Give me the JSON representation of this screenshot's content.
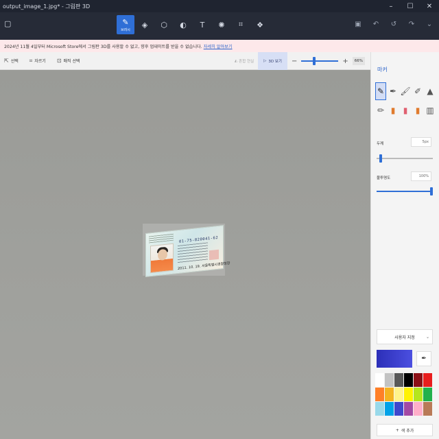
{
  "window": {
    "title": "output_image_1.jpg* - 그림판 3D",
    "controls": [
      "minimize-icon",
      "maximize-icon",
      "close-icon"
    ]
  },
  "toolbar": {
    "menu_icon": "menu-icon",
    "tools": [
      {
        "icon": "brush-icon",
        "label": "브러시",
        "active": true
      },
      {
        "icon": "shapes2d-icon",
        "label": "",
        "active": false
      },
      {
        "icon": "shapes3d-icon",
        "label": "",
        "active": false
      },
      {
        "icon": "sticker-icon",
        "label": "",
        "active": false
      },
      {
        "icon": "text-icon",
        "label": "",
        "active": false
      },
      {
        "icon": "effects-icon",
        "label": "",
        "active": false
      },
      {
        "icon": "canvas-icon",
        "label": "",
        "active": false
      },
      {
        "icon": "library-icon",
        "label": "",
        "active": false
      }
    ],
    "right_icons": [
      "paste-icon",
      "undo-icon",
      "history-icon",
      "redo-icon",
      "more-icon"
    ]
  },
  "notice": {
    "text": "2024년 11월 4일부터 Microsoft Store에서 그림판 3D를 사용할 수 없고, 향후 업데이트를 받을 수 없습니다.",
    "link": "자세히 알아보기"
  },
  "subbar": {
    "select_label": "선택",
    "crop_label": "자르기",
    "magic_select_label": "매직 선택",
    "mixed_reality_label": "혼합 현실",
    "view3d_label": "3D 보기",
    "zoom_value": "66%",
    "zoom_fraction": 0.33
  },
  "canvas": {
    "card_number": "01-75-820041-62",
    "card_issuer": "2011. 10. 19. 서울특별시경찰청장"
  },
  "panel": {
    "title": "마커",
    "brushes": [
      {
        "icon": "marker-icon",
        "active": true,
        "tone": "marker"
      },
      {
        "icon": "calligraphy-pen-icon",
        "active": false,
        "tone": "p-gray"
      },
      {
        "icon": "oil-brush-icon",
        "active": false,
        "tone": "p-gray"
      },
      {
        "icon": "watercolor-icon",
        "active": false,
        "tone": "p-gray"
      },
      {
        "icon": "pixel-pen-icon",
        "active": false,
        "tone": "p-gray"
      },
      {
        "icon": "pencil-icon",
        "active": false,
        "tone": "p-gray"
      },
      {
        "icon": "eraser-icon",
        "active": false,
        "tone": "p-orange"
      },
      {
        "icon": "crayon-icon",
        "active": false,
        "tone": "p-pink"
      },
      {
        "icon": "spray-icon",
        "active": false,
        "tone": "p-orange"
      },
      {
        "icon": "fill-icon",
        "active": false,
        "tone": "p-gray"
      }
    ],
    "thickness_label": "두께",
    "thickness_value": "5px",
    "thickness_fraction": 0.05,
    "opacity_label": "불투명도",
    "opacity_value": "100%",
    "opacity_fraction": 1.0,
    "picker_label": "사용자 지정",
    "current_color": "#3b3fd0",
    "swatches": [
      "#ffffff",
      "#c3c3c3",
      "#585858",
      "#000000",
      "#8b1016",
      "#e81d1d",
      "#ff7f27",
      "#f4b320",
      "#fff38b",
      "#fff200",
      "#b5e61d",
      "#22b14c",
      "#99d9ea",
      "#00a2e8",
      "#3f48cc",
      "#a349a4",
      "#ffaec9",
      "#b97a57"
    ],
    "add_color_label": "색 추가"
  }
}
